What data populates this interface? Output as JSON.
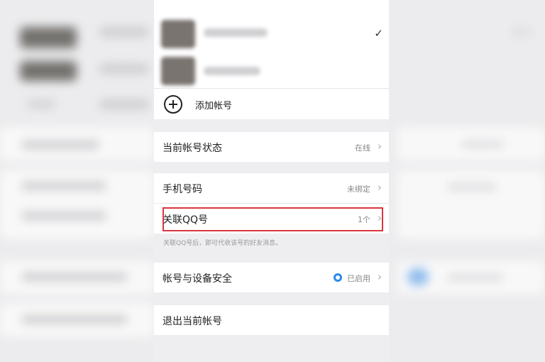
{
  "accounts": {
    "add_label": "添加帐号"
  },
  "rows": {
    "status": {
      "label": "当前帐号状态",
      "value": "在线"
    },
    "phone": {
      "label": "手机号码",
      "value": "未绑定"
    },
    "qq": {
      "label": "关联QQ号",
      "value": "1个",
      "hint": "关联QQ号后，即可代收该号的好友消息。"
    },
    "security": {
      "label": "帐号与设备安全",
      "value": "已启用"
    },
    "logout": {
      "label": "退出当前帐号"
    }
  },
  "colors": {
    "highlight": "#d9363e",
    "accent": "#2c8ae8"
  },
  "icons": {
    "check": "check-icon",
    "add": "plus-circle-icon",
    "chevron": "chevron-right-icon",
    "shield": "shield-icon"
  }
}
